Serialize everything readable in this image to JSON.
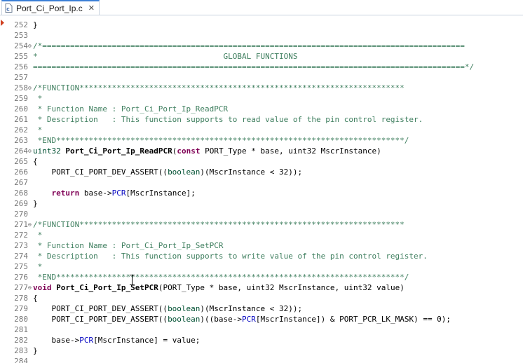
{
  "tab": {
    "title": "Port_Ci_Port_Ip.c",
    "close": "✕"
  },
  "partial_top": "   tatement...   reg   rg.....   a..   .....",
  "lines": [
    {
      "n": "252",
      "fold": "",
      "segs": [
        [
          "p",
          "}"
        ]
      ]
    },
    {
      "n": "253",
      "fold": "",
      "segs": []
    },
    {
      "n": "254",
      "fold": "⊖",
      "segs": [
        [
          "cm",
          "/*==========================================================================================="
        ]
      ]
    },
    {
      "n": "255",
      "fold": "",
      "segs": [
        [
          "cm",
          "*                                        GLOBAL FUNCTIONS"
        ]
      ]
    },
    {
      "n": "256",
      "fold": "",
      "segs": [
        [
          "cm",
          "=============================================================================================*/"
        ]
      ]
    },
    {
      "n": "257",
      "fold": "",
      "segs": []
    },
    {
      "n": "258",
      "fold": "⊖",
      "segs": [
        [
          "cm",
          "/*FUNCTION**********************************************************************"
        ]
      ]
    },
    {
      "n": "259",
      "fold": "",
      "segs": [
        [
          "cm",
          " *"
        ]
      ]
    },
    {
      "n": "260",
      "fold": "",
      "segs": [
        [
          "cm",
          " * Function Name : Port_Ci_Port_Ip_ReadPCR"
        ]
      ]
    },
    {
      "n": "261",
      "fold": "",
      "segs": [
        [
          "cm",
          " * Description   : This function supports to read value of the pin control register."
        ]
      ]
    },
    {
      "n": "262",
      "fold": "",
      "segs": [
        [
          "cm",
          " *"
        ]
      ]
    },
    {
      "n": "263",
      "fold": "",
      "segs": [
        [
          "cm",
          " *END***************************************************************************/"
        ]
      ]
    },
    {
      "n": "264",
      "fold": "⊖",
      "segs": [
        [
          "ty",
          "uint32"
        ],
        [
          "p",
          " "
        ],
        [
          "fn",
          "Port_Ci_Port_Ip_ReadPCR"
        ],
        [
          "p",
          "("
        ],
        [
          "kw",
          "const"
        ],
        [
          "p",
          " PORT_Type * base, uint32 MscrInstance)"
        ]
      ]
    },
    {
      "n": "265",
      "fold": "",
      "segs": [
        [
          "p",
          "{"
        ]
      ]
    },
    {
      "n": "266",
      "fold": "",
      "segs": [
        [
          "p",
          "    PORT_CI_PORT_DEV_ASSERT(("
        ],
        [
          "ty",
          "boolean"
        ],
        [
          "p",
          ")(MscrInstance < 32));"
        ]
      ]
    },
    {
      "n": "267",
      "fold": "",
      "segs": []
    },
    {
      "n": "268",
      "fold": "",
      "segs": [
        [
          "p",
          "    "
        ],
        [
          "kw",
          "return"
        ],
        [
          "p",
          " base->"
        ],
        [
          "fld",
          "PCR"
        ],
        [
          "p",
          "[MscrInstance];"
        ]
      ]
    },
    {
      "n": "269",
      "fold": "",
      "segs": [
        [
          "p",
          "}"
        ]
      ]
    },
    {
      "n": "270",
      "fold": "",
      "segs": []
    },
    {
      "n": "271",
      "fold": "⊖",
      "segs": [
        [
          "cm",
          "/*FUNCTION**********************************************************************"
        ]
      ]
    },
    {
      "n": "272",
      "fold": "",
      "segs": [
        [
          "cm",
          " *"
        ]
      ]
    },
    {
      "n": "273",
      "fold": "",
      "segs": [
        [
          "cm",
          " * Function Name : Port_Ci_Port_Ip_SetPCR"
        ]
      ]
    },
    {
      "n": "274",
      "fold": "",
      "segs": [
        [
          "cm",
          " * Description   : This function supports to write value of the pin control register."
        ]
      ]
    },
    {
      "n": "275",
      "fold": "",
      "segs": [
        [
          "cm",
          " *"
        ]
      ]
    },
    {
      "n": "276",
      "fold": "",
      "segs": [
        [
          "cm",
          " *END***************************************************************************/"
        ]
      ]
    },
    {
      "n": "277",
      "fold": "⊖",
      "segs": [
        [
          "kw",
          "void"
        ],
        [
          "p",
          " "
        ],
        [
          "fn",
          "Port_Ci_Port_Ip_SetPCR"
        ],
        [
          "p",
          "(PORT_Type * base, uint32 MscrInstance, uint32 value)"
        ]
      ]
    },
    {
      "n": "278",
      "fold": "",
      "segs": [
        [
          "p",
          "{"
        ]
      ]
    },
    {
      "n": "279",
      "fold": "",
      "segs": [
        [
          "p",
          "    PORT_CI_PORT_DEV_ASSERT(("
        ],
        [
          "ty",
          "boolean"
        ],
        [
          "p",
          ")(MscrInstance < 32));"
        ]
      ]
    },
    {
      "n": "280",
      "fold": "",
      "segs": [
        [
          "p",
          "    PORT_CI_PORT_DEV_ASSERT(("
        ],
        [
          "ty",
          "boolean"
        ],
        [
          "p",
          ")((base->"
        ],
        [
          "fld",
          "PCR"
        ],
        [
          "p",
          "[MscrInstance]) & PORT_PCR_LK_MASK) == 0);"
        ]
      ]
    },
    {
      "n": "281",
      "fold": "",
      "segs": []
    },
    {
      "n": "282",
      "fold": "",
      "segs": [
        [
          "p",
          "    base->"
        ],
        [
          "fld",
          "PCR"
        ],
        [
          "p",
          "[MscrInstance] = value;"
        ]
      ]
    },
    {
      "n": "283",
      "fold": "",
      "segs": [
        [
          "p",
          "}"
        ]
      ]
    },
    {
      "n": "284",
      "fold": "",
      "segs": []
    }
  ]
}
